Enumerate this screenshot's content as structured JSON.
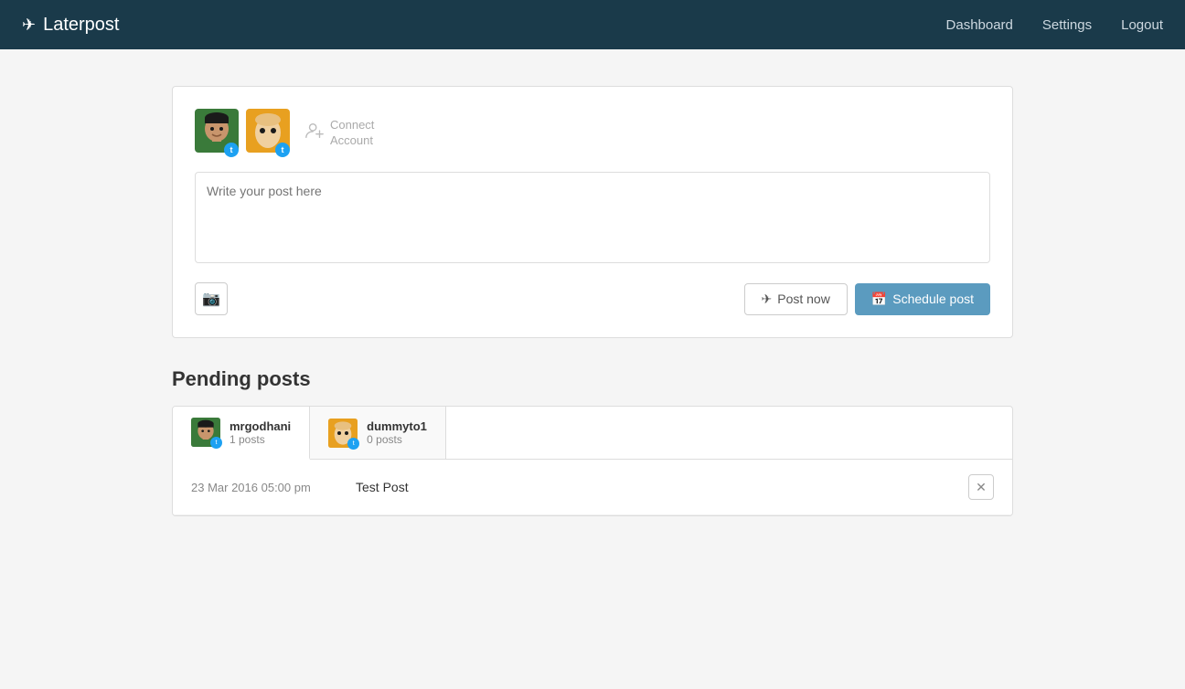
{
  "app": {
    "name": "Laterpost",
    "icon": "✈"
  },
  "navbar": {
    "brand": "Laterpost",
    "links": [
      {
        "label": "Dashboard",
        "key": "dashboard"
      },
      {
        "label": "Settings",
        "key": "settings"
      },
      {
        "label": "Logout",
        "key": "logout"
      }
    ]
  },
  "compose": {
    "placeholder": "Write your post here",
    "camera_btn_label": "📷",
    "post_now_label": "Post now",
    "schedule_label": "Schedule post",
    "connect_account_label": "Connect\nAccount",
    "accounts": [
      {
        "username": "mrgodhani",
        "avatar_type": "face1",
        "platform": "twitter"
      },
      {
        "username": "dummyto1",
        "avatar_type": "face2",
        "platform": "twitter"
      }
    ]
  },
  "pending_posts": {
    "title": "Pending posts",
    "users": [
      {
        "username": "mrgodhani",
        "posts_count": "1 posts",
        "avatar_type": "face1",
        "platform": "twitter",
        "active": true
      },
      {
        "username": "dummyto1",
        "posts_count": "0 posts",
        "avatar_type": "face2",
        "platform": "twitter",
        "active": false
      }
    ],
    "posts": [
      {
        "date": "23 Mar 2016 05:00 pm",
        "text": "Test Post"
      }
    ]
  }
}
